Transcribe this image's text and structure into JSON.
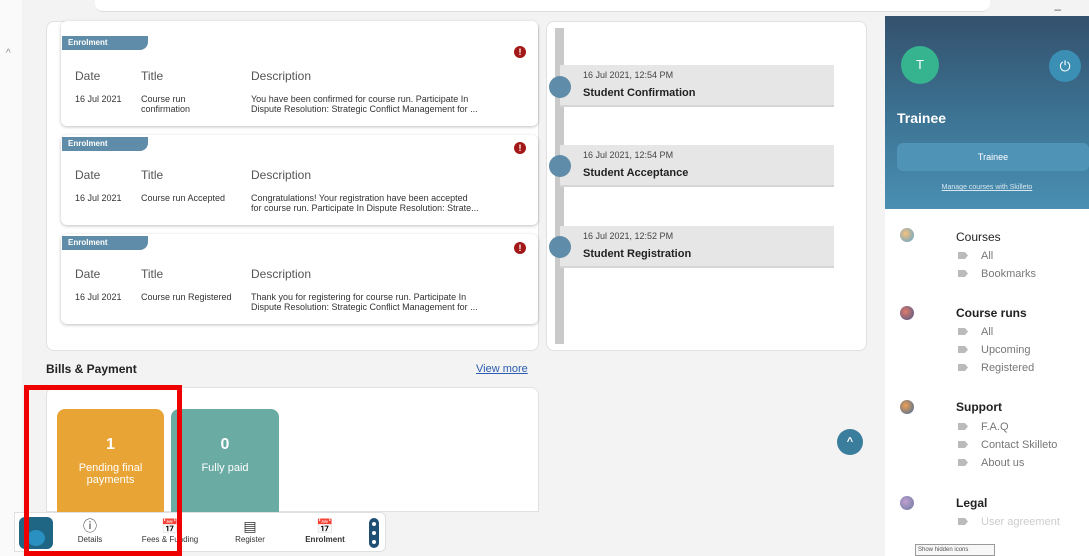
{
  "window": {
    "minimize_glyph": "–",
    "scroll_caret": "^"
  },
  "notifications": [
    {
      "tag": "Enrolment",
      "alert": "!",
      "headers": {
        "date": "Date",
        "title": "Title",
        "description": "Description"
      },
      "date": "16 Jul 2021",
      "title_line1": "Course run",
      "title_line2": "confirmation",
      "desc_line1": "You have been confirmed for course run. Participate In",
      "desc_line2": "Dispute Resolution: Strategic Conflict Management for ..."
    },
    {
      "tag": "Enrolment",
      "alert": "!",
      "headers": {
        "date": "Date",
        "title": "Title",
        "description": "Description"
      },
      "date": "16 Jul 2021",
      "title_line1": "Course run Accepted",
      "title_line2": "",
      "desc_line1": "Congratulations! Your registration have been accepted",
      "desc_line2": "for course run. Participate In Dispute Resolution: Strate..."
    },
    {
      "tag": "Enrolment",
      "alert": "!",
      "headers": {
        "date": "Date",
        "title": "Title",
        "description": "Description"
      },
      "date": "16 Jul 2021",
      "title_line1": "Course run Registered",
      "title_line2": "",
      "desc_line1": "Thank you for registering for course run. Participate In",
      "desc_line2": "Dispute Resolution: Strategic Conflict Management for ..."
    }
  ],
  "timeline": [
    {
      "time": "16 Jul 2021, 12:54 PM",
      "title": "Student Confirmation"
    },
    {
      "time": "16 Jul 2021, 12:54 PM",
      "title": "Student Acceptance"
    },
    {
      "time": "16 Jul 2021, 12:52 PM",
      "title": "Student Registration"
    }
  ],
  "bills": {
    "title": "Bills & Payment",
    "view_more": "View more",
    "pending": {
      "count": "1",
      "label_line1": "Pending final",
      "label_line2": "payments",
      "color": "#e8a535"
    },
    "paid": {
      "count": "0",
      "label": "Fully paid",
      "color": "#6aaba3"
    }
  },
  "scroll_top_glyph": "^",
  "bottom_nav": {
    "items": [
      {
        "label": "Details",
        "icon": "info-icon",
        "glyph": "ⓘ"
      },
      {
        "label": "Fees & Funding",
        "icon": "calendar-clock-icon",
        "glyph": "📅"
      },
      {
        "label": "Register",
        "icon": "document-icon",
        "glyph": "▤"
      },
      {
        "label": "Enrolment",
        "icon": "calendar-clock-icon",
        "glyph": "📅"
      }
    ]
  },
  "sidebar": {
    "avatar_letter": "T",
    "power_glyph": "⏻",
    "role_title": "Trainee",
    "role_button": "Trainee",
    "manage_link": "Manage courses with Skilleto",
    "sections": [
      {
        "title": "Courses",
        "items": [
          "All",
          "Bookmarks"
        ]
      },
      {
        "title": "Course runs",
        "items": [
          "All",
          "Upcoming",
          "Registered"
        ]
      },
      {
        "title": "Support",
        "items": [
          "F.A.Q",
          "Contact Skilleto",
          "About us"
        ]
      },
      {
        "title": "Legal",
        "items": [
          "User agreement"
        ]
      }
    ],
    "tooltip": "Show hidden icons"
  },
  "colors": {
    "accent": "#5f8da9",
    "alert": "#a31919",
    "highlight_box": "#ef0000"
  }
}
